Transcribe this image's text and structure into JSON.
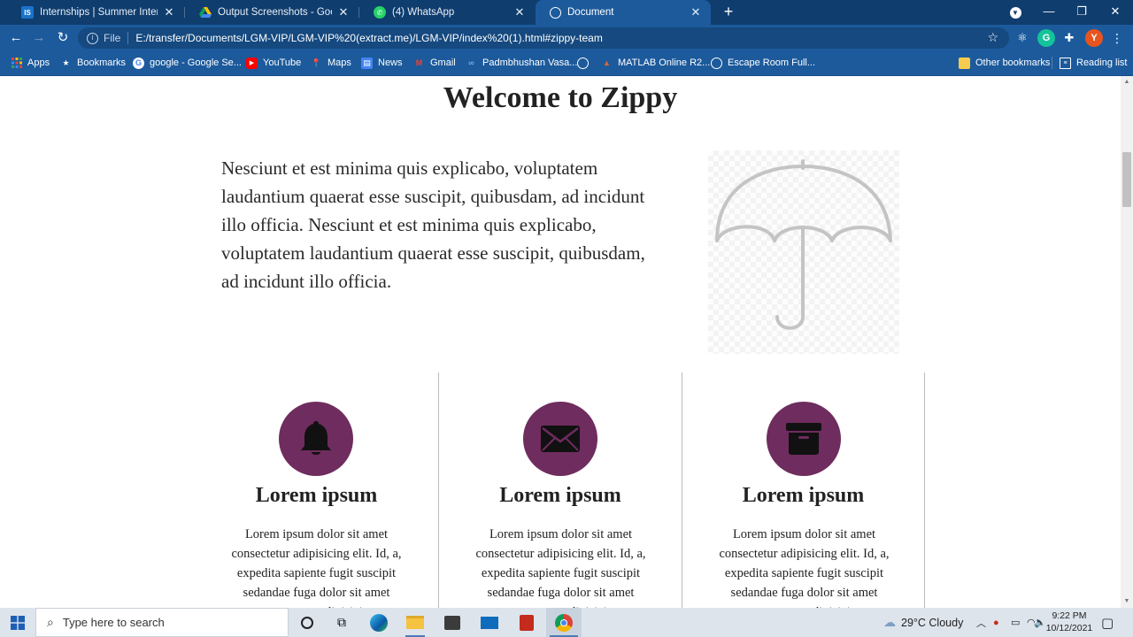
{
  "browser": {
    "tabs": [
      {
        "label": "Internships | Summer Internship",
        "favicon": "IS",
        "active": false
      },
      {
        "label": "Output Screenshots - Google Dr",
        "favicon": "drive-icon",
        "active": false
      },
      {
        "label": "(4) WhatsApp",
        "favicon": "whatsapp-icon",
        "active": false
      },
      {
        "label": "Document",
        "favicon": "globe-icon",
        "active": true
      }
    ],
    "address": {
      "scheme": "File",
      "url": "E:/transfer/Documents/LGM-VIP/LGM-VIP%20(extract.me)/LGM-VIP/index%20(1).html#zippy-team"
    },
    "profile_initial": "Y",
    "bookmarks": [
      "Apps",
      "Bookmarks",
      "google - Google Se...",
      "YouTube",
      "Maps",
      "News",
      "Gmail",
      "Padmbhushan Vasa...",
      "",
      "MATLAB Online R2...",
      "Escape Room Full..."
    ],
    "other_bookmarks": "Other bookmarks",
    "reading_list": "Reading list"
  },
  "page": {
    "title": "Welcome to Zippy",
    "intro": "Nesciunt et est minima quis explicabo, voluptatem laudantium quaerat esse suscipit, quibusdam, ad incidunt illo officia. Nesciunt et est minima quis explicabo, voluptatem laudantium quaerat esse suscipit, quibusdam, ad incidunt illo officia.",
    "features": [
      {
        "icon": "bell-icon",
        "title": "Lorem ipsum",
        "text": "Lorem ipsum dolor sit amet consectetur adipisicing elit. Id, a, expedita sapiente fugit suscipit sedandae fuga dolor sit amet consectetur adipisicing"
      },
      {
        "icon": "envelope-icon",
        "title": "Lorem ipsum",
        "text": "Lorem ipsum dolor sit amet consectetur adipisicing elit. Id, a, expedita sapiente fugit suscipit sedandae fuga dolor sit amet consectetur adipisicing"
      },
      {
        "icon": "archive-icon",
        "title": "Lorem ipsum",
        "text": "Lorem ipsum dolor sit amet consectetur adipisicing elit. Id, a, expedita sapiente fugit suscipit sedandae fuga dolor sit amet consectetur adipisicing"
      }
    ],
    "accent_color": "#6f2c5e"
  },
  "taskbar": {
    "search_placeholder": "Type here to search",
    "weather": "29°C  Cloudy",
    "time": "9:22 PM",
    "date": "10/12/2021"
  }
}
